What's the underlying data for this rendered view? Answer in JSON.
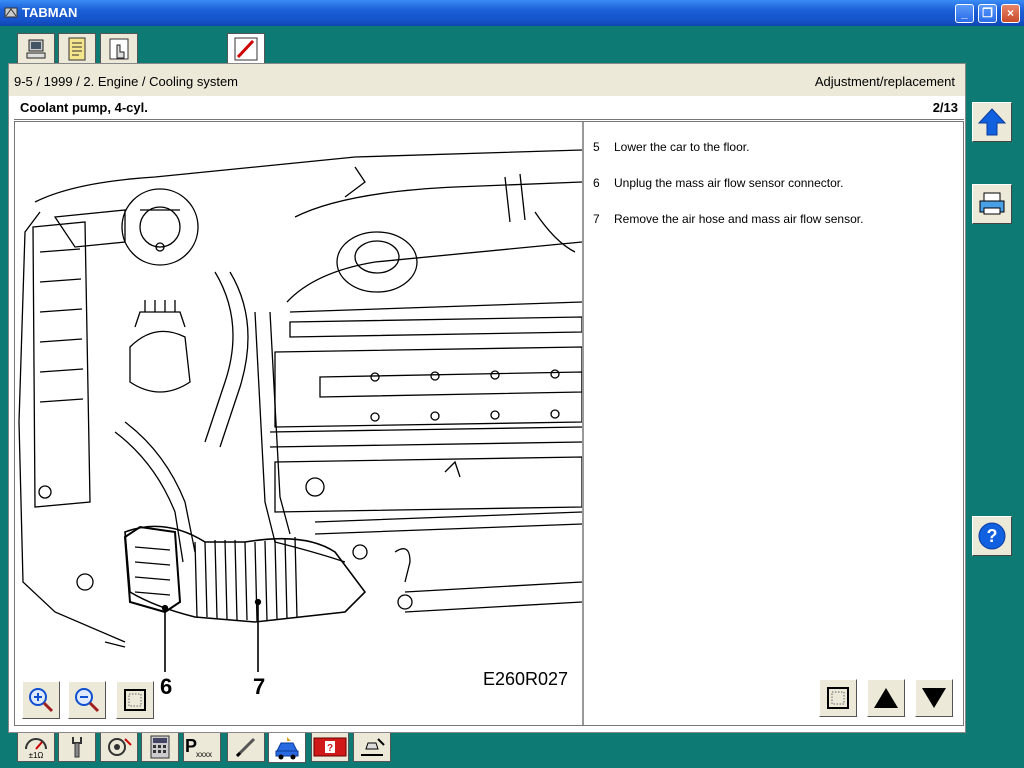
{
  "window": {
    "title": "TABMAN",
    "minimize_label": "_",
    "restore_label": "❐",
    "close_label": "×"
  },
  "top_tabs": [
    {
      "name": "computer-icon"
    },
    {
      "name": "notes-icon"
    },
    {
      "name": "hand-pointer-icon"
    },
    {
      "name": "pencil-icon"
    }
  ],
  "breadcrumb": "9-5 / 1999 / 2. Engine / Cooling system",
  "section_type": "Adjustment/replacement",
  "page": {
    "title": "Coolant pump, 4-cyl.",
    "counter": "2/13"
  },
  "illustration": {
    "callout_6": "6",
    "callout_7": "7",
    "figure_code": "E260R027"
  },
  "steps": [
    {
      "num": "5",
      "text": "Lower the car to the floor."
    },
    {
      "num": "6",
      "text": "Unplug the mass air flow sensor connector."
    },
    {
      "num": "7",
      "text": "Remove the air hose and mass air flow sensor."
    }
  ],
  "zoom_controls": [
    "zoom-in-icon",
    "zoom-out-icon",
    "fit-frame-icon"
  ],
  "nav_controls": [
    "frame-icon",
    "arrow-up-icon",
    "arrow-down-icon"
  ],
  "side_buttons": [
    "arrow-up-icon",
    "print-icon",
    "help-icon"
  ],
  "bottom_tabs": [
    "gauge-icon",
    "wrench-icon",
    "diagnostic-icon",
    "calculator-icon",
    "parts-code-icon",
    "pencil-icon",
    "car-service-icon",
    "fault-code-icon",
    "stamp-icon"
  ],
  "colors": {
    "background": "#0d7a74",
    "titlebar": "#1a5fd6",
    "accent_blue": "#1060e0"
  }
}
